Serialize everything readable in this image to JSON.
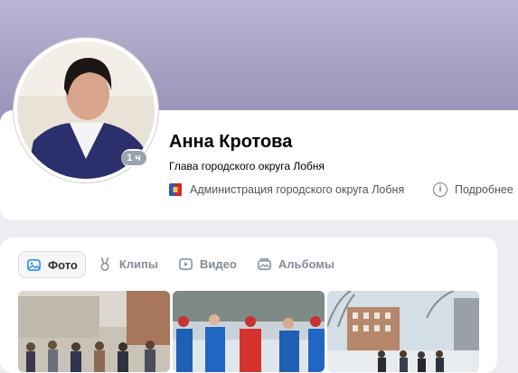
{
  "profile": {
    "name": "Анна Кротова",
    "status": "Глава городского округа Лобня",
    "online_badge": "1 ч",
    "organization": "Администрация городского округа Лобня",
    "more_info": "Подробнее"
  },
  "media": {
    "tabs": [
      {
        "label": "Фото",
        "icon": "photo-icon",
        "active": true
      },
      {
        "label": "Клипы",
        "icon": "clips-icon",
        "active": false
      },
      {
        "label": "Видео",
        "icon": "video-icon",
        "active": false
      },
      {
        "label": "Альбомы",
        "icon": "albums-icon",
        "active": false
      }
    ]
  },
  "colors": {
    "cover": "#a7a1c4",
    "background": "#ebedf0",
    "card": "#ffffff",
    "muted_text": "#818c99",
    "badge": "#99a2ad"
  }
}
